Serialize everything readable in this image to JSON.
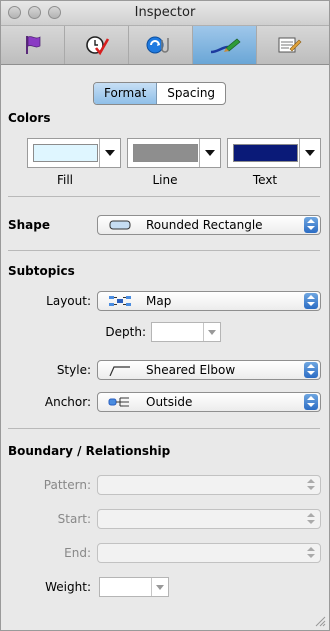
{
  "window": {
    "title": "Inspector"
  },
  "toolbar": {
    "tabs": [
      {
        "name": "flag-tab",
        "icon": "flag-icon",
        "active": false
      },
      {
        "name": "clock-check-tab",
        "icon": "clock-check-icon",
        "active": false
      },
      {
        "name": "link-attachment-tab",
        "icon": "link-attachment-icon",
        "active": false
      },
      {
        "name": "pen-style-tab",
        "icon": "pen-icon",
        "active": true
      },
      {
        "name": "document-tab",
        "icon": "document-icon",
        "active": false
      }
    ]
  },
  "segments": {
    "format": "Format",
    "spacing": "Spacing",
    "selected": "Format"
  },
  "colors": {
    "title": "Colors",
    "fill": {
      "label": "Fill",
      "color": "#dff6ff"
    },
    "line": {
      "label": "Line",
      "color": "#8e8e8e"
    },
    "text": {
      "label": "Text",
      "color": "#0a1a78"
    }
  },
  "shape": {
    "label": "Shape",
    "value": "Rounded Rectangle"
  },
  "subtopics": {
    "title": "Subtopics",
    "layout": {
      "label": "Layout:",
      "value": "Map"
    },
    "depth": {
      "label": "Depth:",
      "value": ""
    },
    "style": {
      "label": "Style:",
      "value": "Sheared Elbow"
    },
    "anchor": {
      "label": "Anchor:",
      "value": "Outside"
    }
  },
  "boundary": {
    "title": "Boundary / Relationship",
    "pattern": {
      "label": "Pattern:",
      "value": ""
    },
    "start": {
      "label": "Start:",
      "value": ""
    },
    "end": {
      "label": "End:",
      "value": ""
    },
    "weight": {
      "label": "Weight:",
      "value": ""
    }
  }
}
